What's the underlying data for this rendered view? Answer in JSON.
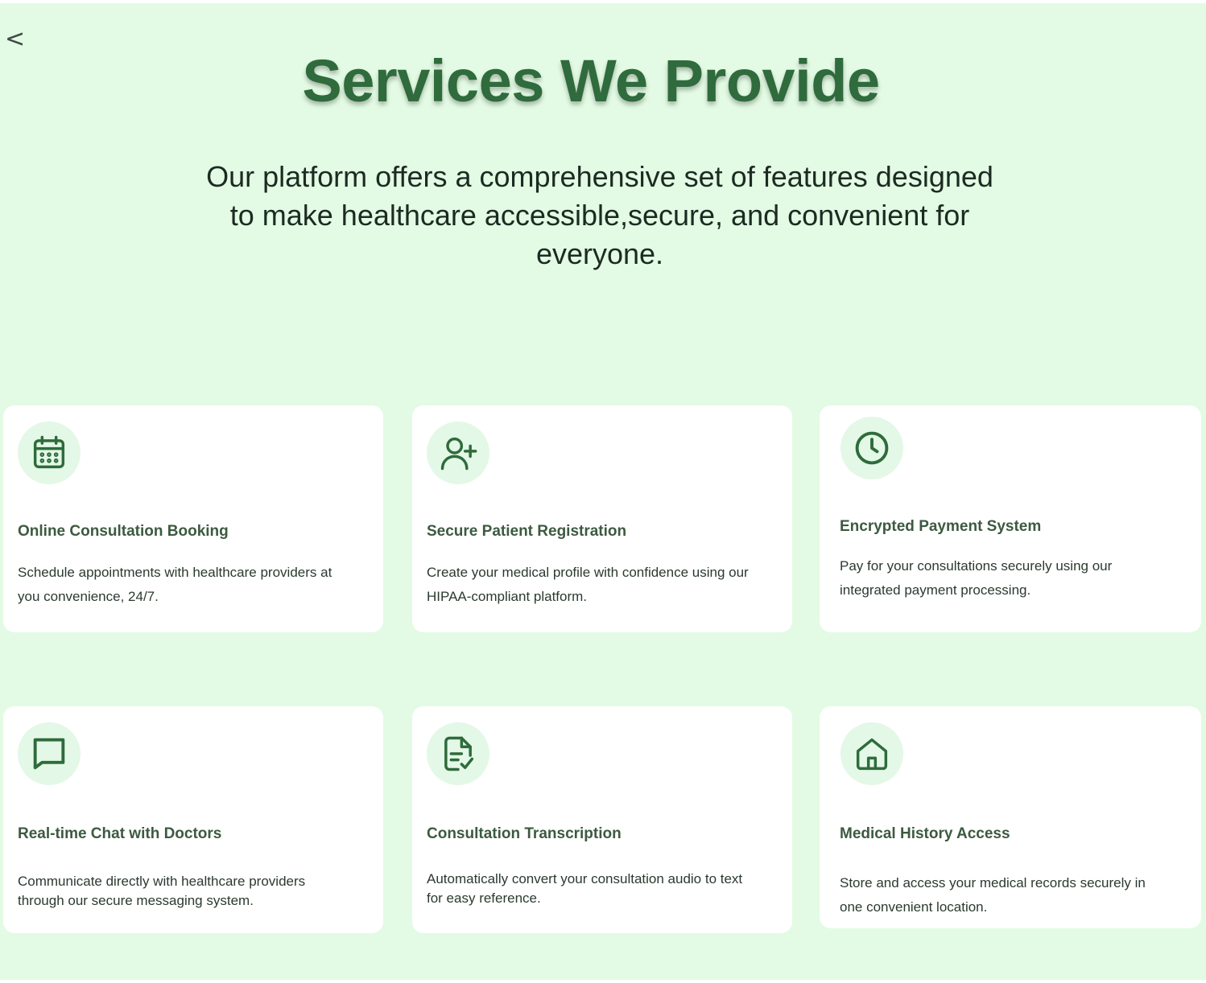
{
  "nav": {
    "back_label": "<"
  },
  "header": {
    "title": "Services We Provide",
    "subtitle": "Our platform offers a comprehensive set of features designed to make healthcare accessible,secure, and convenient for everyone."
  },
  "colors": {
    "page_background": "#e3fbe4",
    "accent_green": "#2f6b3c",
    "icon_circle": "#e3f8e6",
    "card_background": "#ffffff"
  },
  "services": [
    {
      "icon": "calendar-icon",
      "title": "Online Consultation Booking",
      "description": "Schedule appointments with healthcare providers at you convenience, 24/7."
    },
    {
      "icon": "user-plus-icon",
      "title": "Secure Patient Registration",
      "description": "Create your medical profile with confidence using our HIPAA-compliant platform."
    },
    {
      "icon": "clock-icon",
      "title": "Encrypted Payment System",
      "description": "Pay for your consultations securely using our integrated payment processing."
    },
    {
      "icon": "chat-icon",
      "title": "Real-time Chat with Doctors",
      "description": "Communicate directly with healthcare providers through our secure messaging system."
    },
    {
      "icon": "document-check-icon",
      "title": "Consultation Transcription",
      "description": "Automatically convert your consultation audio to text for easy reference."
    },
    {
      "icon": "home-icon",
      "title": "Medical History Access",
      "description": "Store and access your medical records securely in one convenient location."
    }
  ]
}
